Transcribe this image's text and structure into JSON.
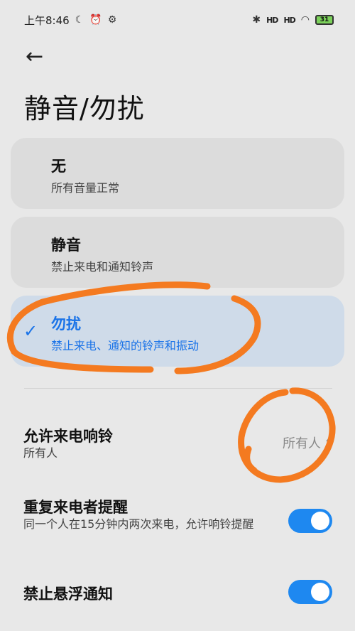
{
  "status_bar": {
    "time": "上午8:46",
    "moon_icon": "☾",
    "alarm_icon": "⏰",
    "app_icon": "⚙",
    "bluetooth_icon": "✱",
    "signal1": "HD",
    "signal2": "HD",
    "wifi_icon": "◠",
    "battery": "31"
  },
  "header": {
    "back_icon": "←",
    "title": "静音/勿扰"
  },
  "modes": [
    {
      "title": "无",
      "subtitle": "所有音量正常"
    },
    {
      "title": "静音",
      "subtitle": "禁止来电和通知铃声"
    },
    {
      "title": "勿扰",
      "subtitle": "禁止来电、通知的铃声和振动",
      "check": "✓"
    }
  ],
  "settings": {
    "allow_calls": {
      "title": "允许来电响铃",
      "subtitle": "所有人",
      "value": "所有人",
      "arrow": "⌃⌄"
    },
    "repeat_callers": {
      "title": "重复来电者提醒",
      "subtitle": "同一个人在15分钟内两次来电，允许响铃提醒"
    },
    "block_floating": {
      "title": "禁止悬浮通知"
    }
  },
  "colors": {
    "accent": "#1a73e8",
    "toggle_on": "#1e88f0",
    "annotation": "#f47a20"
  }
}
